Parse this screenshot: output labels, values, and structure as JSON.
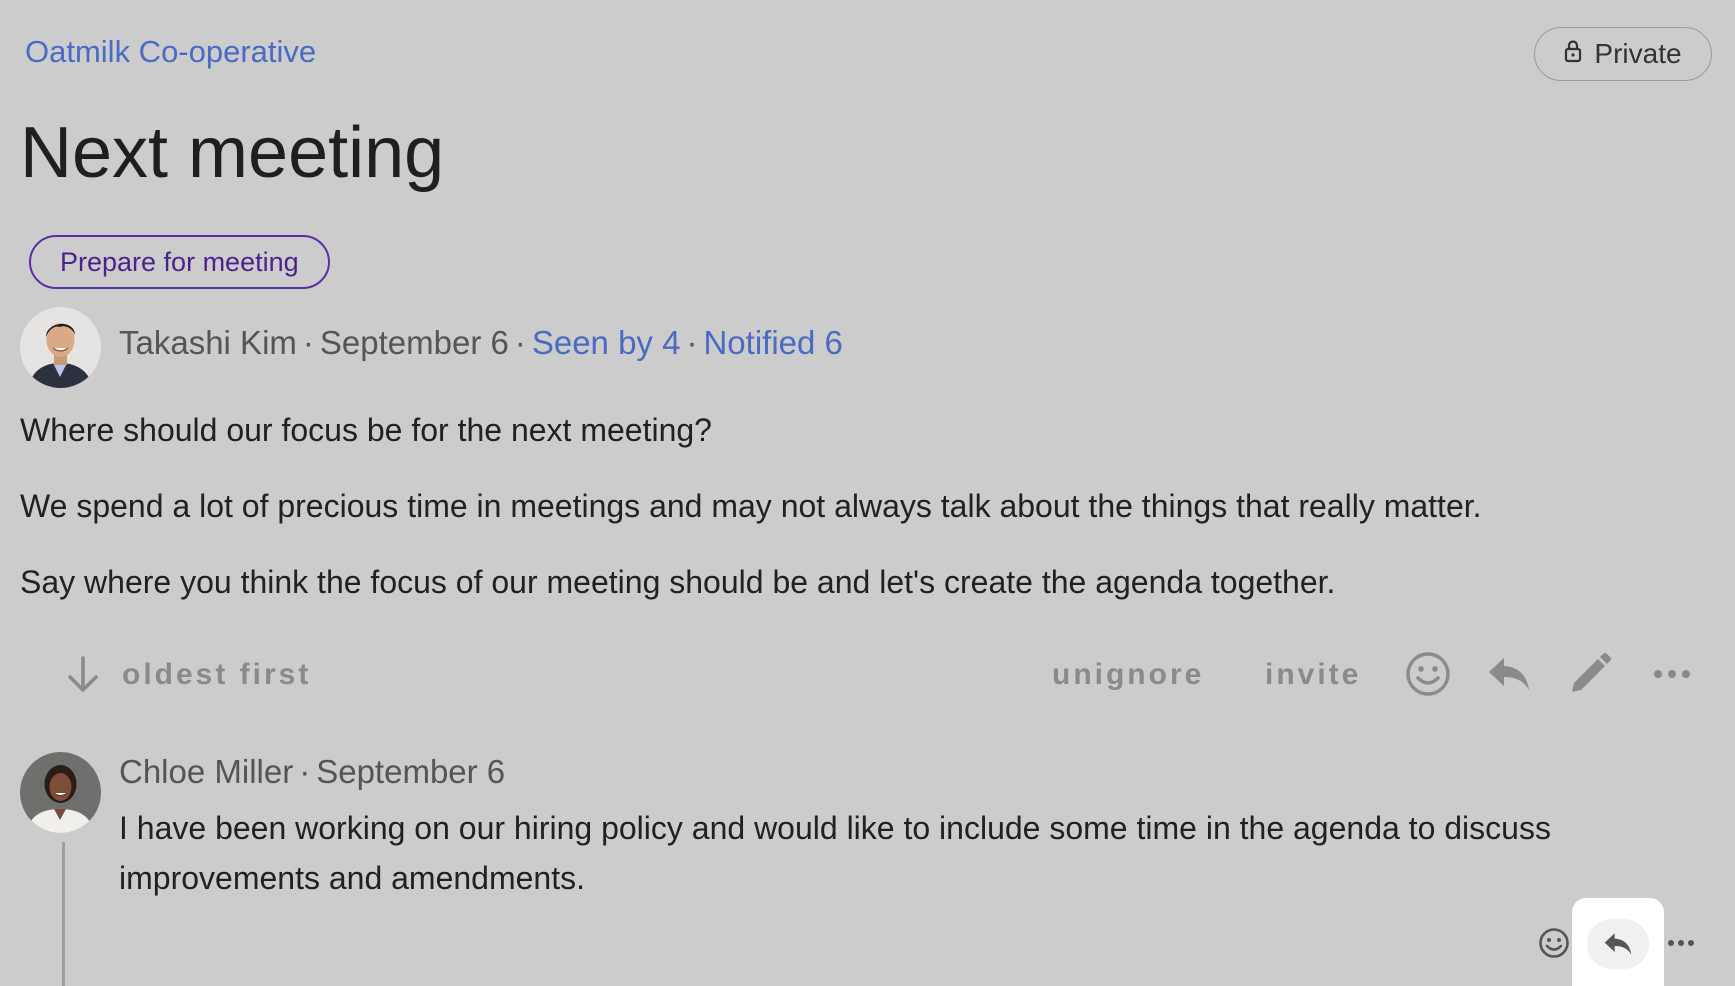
{
  "header": {
    "group_name": "Oatmilk Co-operative",
    "privacy_label": "Private",
    "privacy_icon": "lock-icon"
  },
  "discussion": {
    "title": "Next meeting",
    "tag": "Prepare for meeting",
    "author": "Takashi Kim",
    "date": "September 6",
    "seen_by": "Seen by 4",
    "notified": "Notified 6",
    "paragraphs": [
      "Where should our focus be for the next meeting?",
      "We spend a lot of precious time in meetings and may not always talk about the things that really matter.",
      "Say where you think the focus of our meeting should be and let's create the agenda together."
    ]
  },
  "actions": {
    "sort_label": "oldest first",
    "sort_icon": "arrow-down-icon",
    "unignore_label": "unignore",
    "invite_label": "invite",
    "icons": [
      "emoji-icon",
      "reply-icon",
      "edit-icon",
      "more-icon"
    ]
  },
  "comment": {
    "author": "Chloe Miller",
    "date": "September 6",
    "text_line1": "I have been working on our hiring policy and would like to include some time in the agenda to discuss",
    "text_line2": "improvements and amendments.",
    "icons": [
      "emoji-icon",
      "reply-icon",
      "more-icon"
    ]
  },
  "colors": {
    "background": "#cccccc",
    "link": "#4a6bc4",
    "tag_border": "#5b2fa5"
  }
}
